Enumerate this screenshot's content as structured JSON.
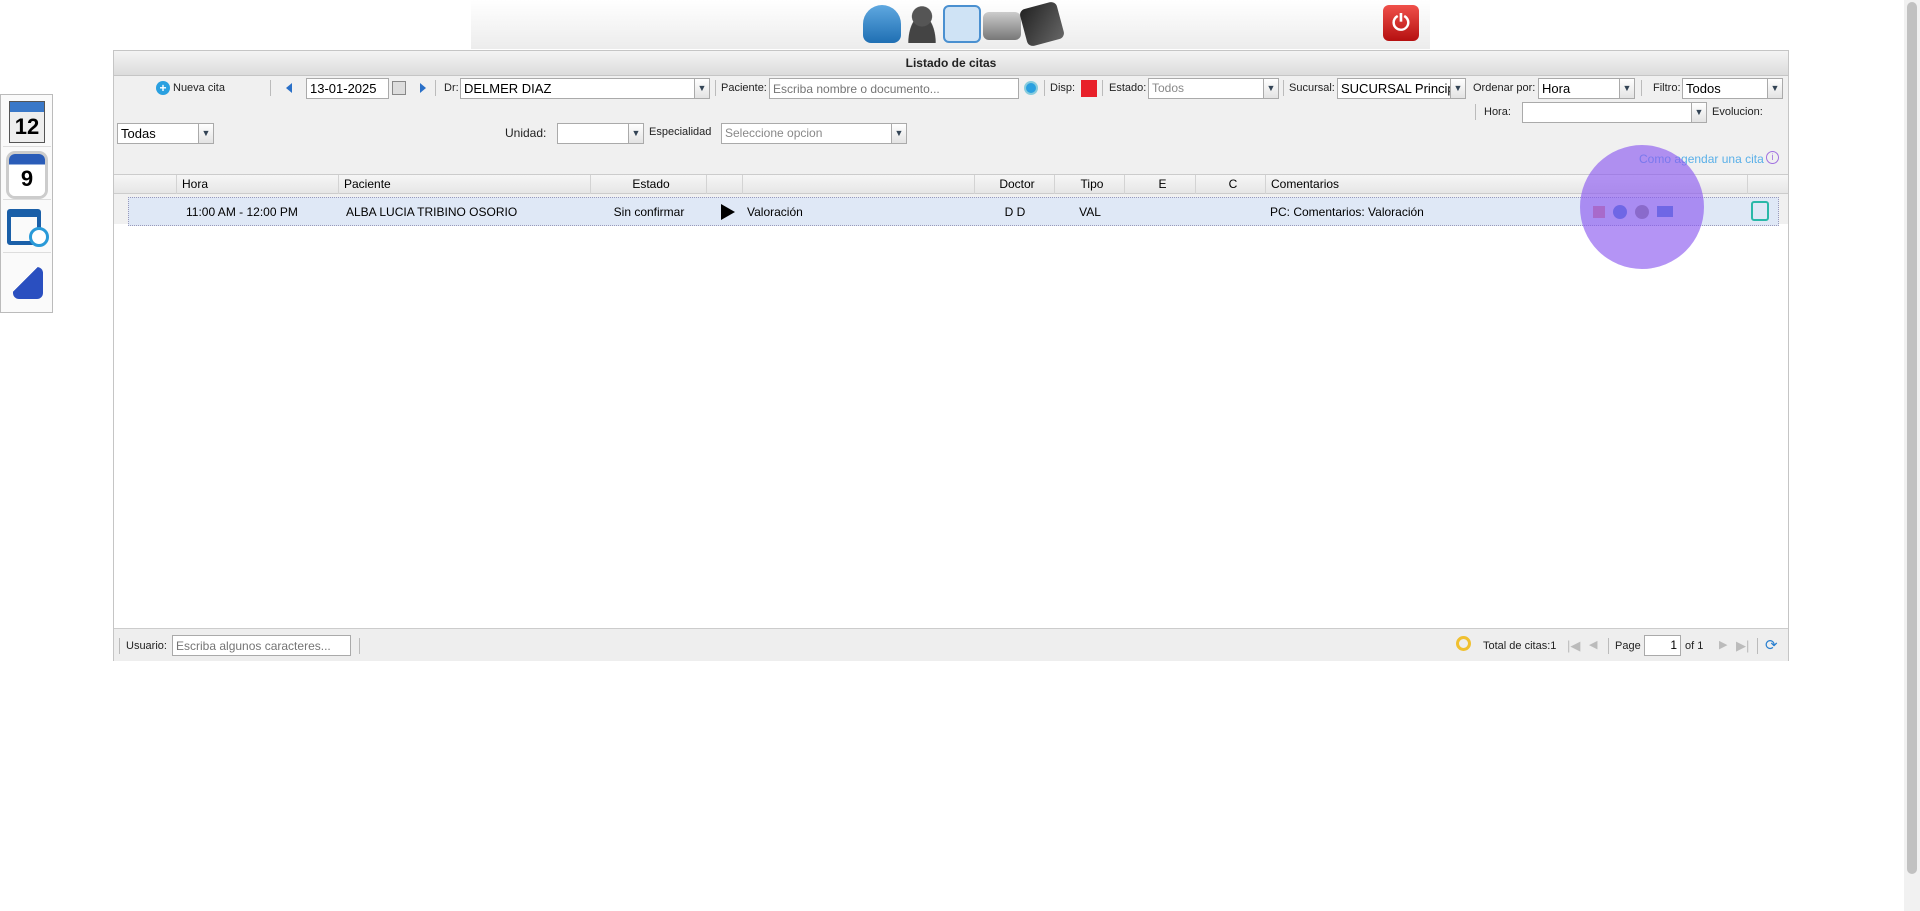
{
  "header": {
    "icons": [
      "back-arrow-icon",
      "add-patient-icon",
      "patients-icon",
      "printer-icon",
      "cash-register-icon"
    ],
    "power": "power-icon"
  },
  "panel_title": "Listado de citas",
  "toolbar": {
    "new_label": "Nueva cita",
    "date": "13-01-2025",
    "dr_label": "Dr:",
    "dr_value": "DELMER DIAZ",
    "patient_label": "Paciente:",
    "patient_placeholder": "Escriba nombre o documento...",
    "disp_label": "Disp:",
    "disp_color": "#e8202a",
    "estado_label": "Estado:",
    "estado_value": "Todos",
    "sucursal_label": "Sucursal:",
    "sucursal_value": "SUCURSAL Princip",
    "ordenar_label": "Ordenar por:",
    "ordenar_value": "Hora",
    "filtro_label": "Filtro:",
    "filtro_value": "Todos",
    "hora_label": "Hora:",
    "hora_value": "",
    "evolucion_label": "Evolucion:",
    "todas_value": "Todas",
    "unidad_label": "Unidad:",
    "unidad_value": "",
    "especialidad_label": "Especialidad",
    "especialidad_placeholder": "Seleccione opcion",
    "help_link": "Como agendar una cita"
  },
  "grid": {
    "columns": [
      "Hora",
      "Paciente",
      "Estado",
      "",
      "Doctor",
      "Tipo",
      "E",
      "C",
      "Comentarios"
    ],
    "rows": [
      {
        "hora": "11:00 AM - 12:00 PM",
        "paciente": "ALBA LUCIA TRIBINO OSORIO",
        "estado": "Sin confirmar",
        "motivo": "Valoración",
        "doctor": "D D",
        "tipo": "VAL",
        "e": "",
        "c": "",
        "comentarios": "PC: Comentarios: Valoración"
      }
    ]
  },
  "footer": {
    "user_label": "Usuario:",
    "user_placeholder": "Escriba algunos caracteres...",
    "total": "Total de citas:1",
    "page_label": "Page",
    "page": "1",
    "of": "of 1"
  }
}
